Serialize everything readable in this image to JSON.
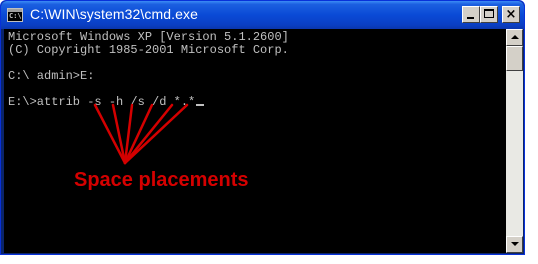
{
  "window": {
    "title": "C:\\WIN\\system32\\cmd.exe",
    "icon": "cmd-icon",
    "icon_glyph": "C:\\"
  },
  "console": {
    "lines": [
      "Microsoft Windows XP [Version 5.1.2600]",
      "(C) Copyright 1985-2001 Microsoft Corp.",
      "",
      "C:\\ admin>E:",
      "",
      "E:\\>attrib -s -h /s /d *.*"
    ],
    "text_color": "#c0c0c0",
    "background_color": "#000000"
  },
  "annotation": {
    "label": "Space placements",
    "color": "#d40000"
  }
}
